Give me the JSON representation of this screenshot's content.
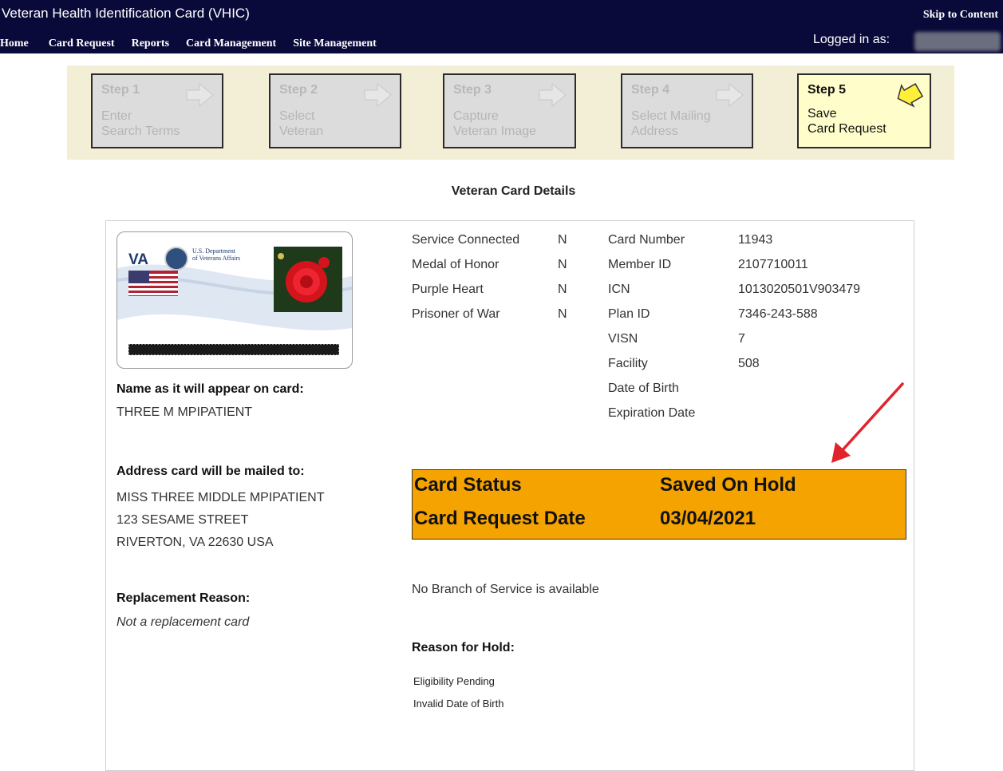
{
  "header": {
    "title": "Veteran Health Identification Card (VHIC)",
    "skip": "Skip to Content",
    "nav": [
      "Home",
      "Card Request",
      "Reports",
      "Card Management",
      "Site Management"
    ],
    "logged_in": "Logged in as:"
  },
  "steps": [
    {
      "num": "Step 1",
      "line1": "Enter",
      "line2": "Search Terms"
    },
    {
      "num": "Step 2",
      "line1": "Select",
      "line2": "Veteran"
    },
    {
      "num": "Step 3",
      "line1": "Capture",
      "line2": "Veteran Image"
    },
    {
      "num": "Step 4",
      "line1": "Select Mailing",
      "line2": "Address"
    },
    {
      "num": "Step 5",
      "line1": "Save",
      "line2": "Card Request"
    }
  ],
  "section_title": "Veteran Card Details",
  "card_image": {
    "va_logo": "VA",
    "dept_line1": "U.S. Department",
    "dept_line2": "of Veterans Affairs"
  },
  "name_label": "Name as it will appear on card:",
  "name_value": "THREE M MPIPATIENT",
  "address_label": "Address card will be mailed to:",
  "address": [
    "MISS THREE MIDDLE MPIPATIENT",
    "123 SESAME STREET",
    "RIVERTON, VA 22630 USA"
  ],
  "replacement_label": "Replacement Reason:",
  "replacement_value": "Not a replacement card",
  "flags": [
    {
      "label": "Service Connected",
      "value": "N"
    },
    {
      "label": "Medal of Honor",
      "value": "N"
    },
    {
      "label": "Purple Heart",
      "value": "N"
    },
    {
      "label": "Prisoner of War",
      "value": "N"
    }
  ],
  "details": [
    {
      "label": "Card Number",
      "value": "11943"
    },
    {
      "label": "Member ID",
      "value": "2107710011"
    },
    {
      "label": "ICN",
      "value": "1013020501V903479"
    },
    {
      "label": "Plan ID",
      "value": "7346-243-588"
    },
    {
      "label": "VISN",
      "value": "7"
    },
    {
      "label": "Facility",
      "value": "508"
    },
    {
      "label": "Date of Birth",
      "value": ""
    },
    {
      "label": "Expiration Date",
      "value": ""
    }
  ],
  "status": {
    "status_label": "Card Status",
    "status_value": "Saved On Hold",
    "date_label": "Card Request Date",
    "date_value": "03/04/2021",
    "color": "#f5a300"
  },
  "branch_text": "No Branch of Service is available",
  "hold_label": "Reason for Hold:",
  "hold_reasons": [
    "Eligibility Pending",
    "Invalid Date of Birth"
  ],
  "annotation_color": "#e0242e"
}
